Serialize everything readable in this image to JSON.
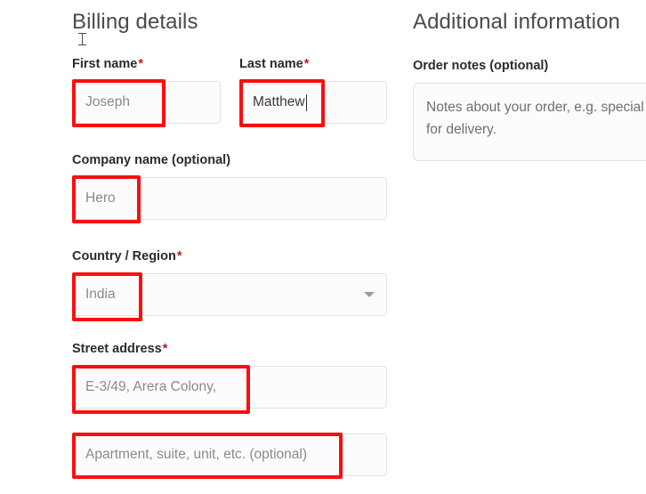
{
  "page": {
    "background": "#ffffff",
    "highlight_color": "#fa0f0f",
    "required_marker_color": "#b02020"
  },
  "billing": {
    "heading": "Billing details",
    "fields": [
      {
        "label": "First name",
        "required_marker": "*",
        "value": "Joseph",
        "filled": false,
        "highlighted": true
      },
      {
        "label": "Last name",
        "required_marker": "*",
        "value": "Matthew",
        "filled": true,
        "highlighted": true
      },
      {
        "label": "Company name (optional)",
        "required_marker": "",
        "value": "Hero",
        "filled": false,
        "highlighted": true
      },
      {
        "label": "Country / Region",
        "required_marker": "*",
        "value": "India",
        "filled": false,
        "highlighted": true,
        "control": "select",
        "icon": "chevron-down-icon"
      },
      {
        "label": "Street address",
        "required_marker": "*",
        "value": "E-3/49, Arera Colony,",
        "filled": false,
        "highlighted": true
      },
      {
        "label": "",
        "required_marker": "",
        "value": "Apartment, suite, unit, etc. (optional)",
        "filled": false,
        "highlighted": true
      }
    ]
  },
  "additional": {
    "heading": "Additional information",
    "order_notes_label": "Order notes (optional)",
    "order_notes_placeholder": "Notes about your order, e.g. special notes for delivery."
  },
  "cursor": {
    "icon": "text-ibeam-cursor"
  }
}
